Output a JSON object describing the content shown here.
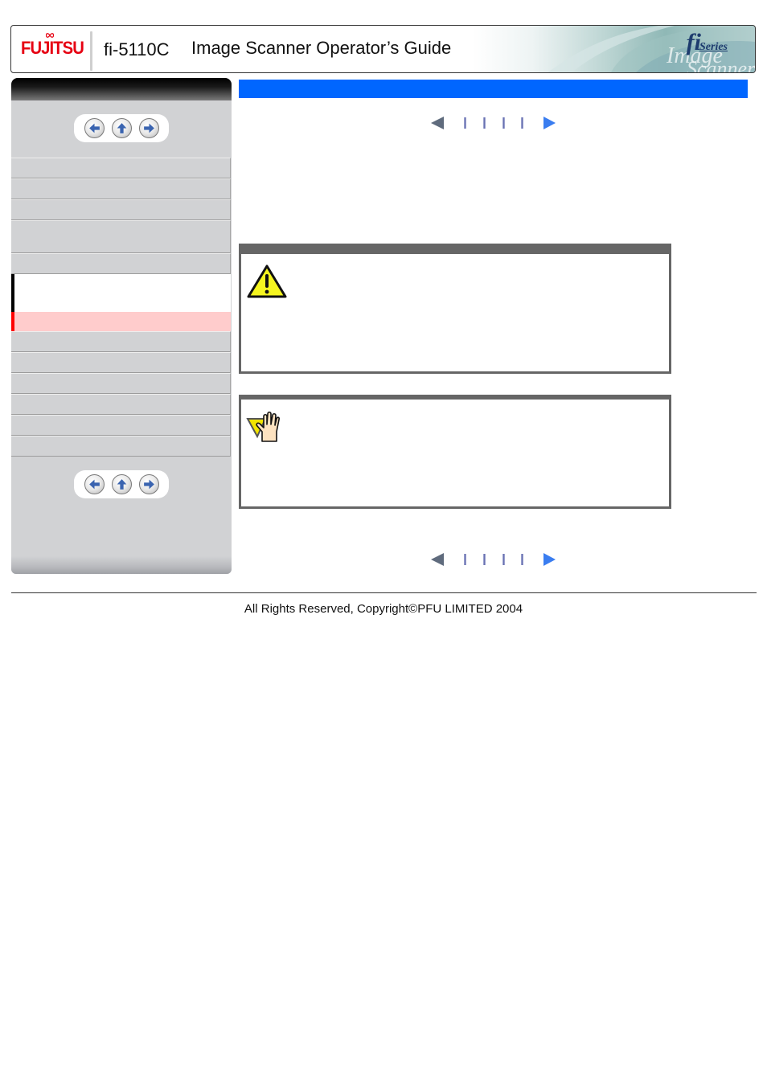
{
  "header": {
    "brand": "FUJITSU",
    "model": "fi-5110C",
    "title": "Image Scanner Operator’s Guide",
    "series_logo": "fi",
    "series_label": "Series",
    "colors": {
      "brand": "#e60012"
    }
  },
  "sidebar": {
    "nav_top": [
      {
        "icon": "arrow-left-icon",
        "label": "Back"
      },
      {
        "icon": "arrow-up-icon",
        "label": "Up"
      },
      {
        "icon": "arrow-right-icon",
        "label": "Forward"
      }
    ],
    "menu_items": [
      {
        "label": "",
        "state": "normal"
      },
      {
        "label": "",
        "state": "normal"
      },
      {
        "label": "",
        "state": "normal"
      },
      {
        "label": "",
        "state": "normal"
      },
      {
        "label": "",
        "state": "normal"
      },
      {
        "label": "",
        "state": "expanded"
      },
      {
        "label": "",
        "state": "selected"
      },
      {
        "label": "",
        "state": "normal"
      },
      {
        "label": "",
        "state": "normal"
      },
      {
        "label": "",
        "state": "normal"
      },
      {
        "label": "",
        "state": "normal"
      },
      {
        "label": "",
        "state": "normal"
      },
      {
        "label": "",
        "state": "normal"
      }
    ],
    "nav_bottom": [
      {
        "icon": "arrow-left-icon",
        "label": "Back"
      },
      {
        "icon": "arrow-up-icon",
        "label": "Up"
      },
      {
        "icon": "arrow-right-icon",
        "label": "Forward"
      }
    ],
    "colors": {
      "background": "#d1d2d4",
      "selected": "#ffcccc",
      "selected_marker": "#ff0000"
    }
  },
  "main": {
    "title": "",
    "title_color": "#0066ff",
    "pager": {
      "prev_icon": "triangle-left-icon",
      "next_icon": "triangle-right-icon",
      "page_markers": 4
    },
    "caution": {
      "icon": "warning-triangle-icon",
      "heading": "",
      "text": ""
    },
    "hint": {
      "icon": "raised-hand-icon",
      "heading": "",
      "text": ""
    }
  },
  "footer": {
    "copyright": "All Rights Reserved,  Copyright©PFU LIMITED 2004"
  }
}
